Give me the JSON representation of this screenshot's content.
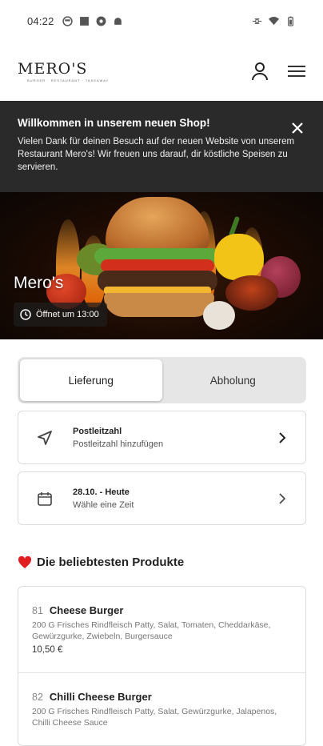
{
  "status_bar": {
    "time": "04:22"
  },
  "header": {
    "logo": "MERO'S",
    "logo_sub": "BURGER · RESTAURANT · TAKEAWAY"
  },
  "banner": {
    "title": "Willkommen in unserem neuen Shop!",
    "text": "Vielen Dank für deinen Besuch auf der neuen Website von unserem Restaurant Mero's! Wir freuen uns darauf, dir köstliche Speisen zu servieren."
  },
  "hero": {
    "title": "Mero's",
    "opens": "Öffnet um 13:00"
  },
  "toggle": {
    "delivery": "Lieferung",
    "pickup": "Abholung",
    "active": "delivery"
  },
  "postcode_card": {
    "title": "Postleitzahl",
    "subtitle": "Postleitzahl hinzufügen"
  },
  "date_card": {
    "title": "28.10. - Heute",
    "subtitle": "Wähle eine Zeit"
  },
  "section": {
    "title": "Die beliebtesten Produkte"
  },
  "products": [
    {
      "number": "81",
      "name": "Cheese Burger",
      "description": "200 G Frisches Rindfleisch Patty, Salat, Tomaten, Cheddarkäse, Gewürzgurke, Zwiebeln, Burgersauce",
      "price": "10,50 €"
    },
    {
      "number": "82",
      "name": "Chilli Cheese Burger",
      "description": "200 G Frisches Rindfleisch Patty, Salat, Gewürzgurke, Jalapenos, Chilli Cheese Sauce",
      "price": ""
    }
  ],
  "colors": {
    "banner_bg": "#2a2a2a",
    "heart": "#e02020",
    "toggle_bg": "#e6e6e6"
  }
}
